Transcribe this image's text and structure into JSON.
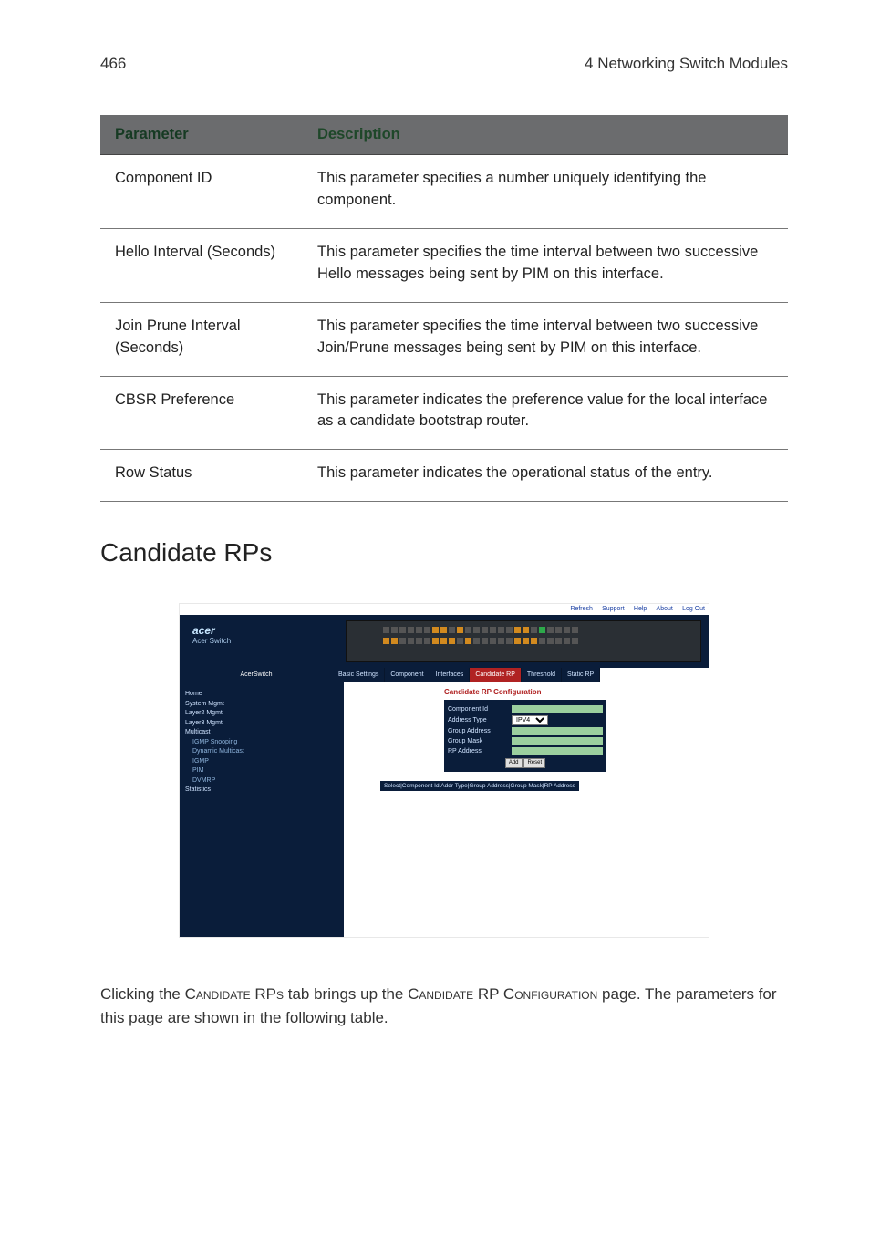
{
  "header": {
    "page_number": "466",
    "section": "4 Networking Switch Modules"
  },
  "table": {
    "col_param": "Parameter",
    "col_desc": "Description",
    "rows": [
      {
        "param": "Component ID",
        "desc": "This parameter specifies a number uniquely identifying the component."
      },
      {
        "param": "Hello Interval (Seconds)",
        "desc": "This parameter specifies the time interval between two successive Hello messages being sent by PIM on this interface."
      },
      {
        "param": "Join Prune Interval (Seconds)",
        "desc": "This parameter specifies the time interval between two successive Join/Prune messages being sent by PIM on this interface."
      },
      {
        "param": "CBSR Preference",
        "desc": "This parameter indicates the preference value for the local interface as a candidate bootstrap router."
      },
      {
        "param": "Row Status",
        "desc": "This parameter indicates the operational status of the entry."
      }
    ]
  },
  "heading": "Candidate RPs",
  "screenshot": {
    "top_links": [
      "Refresh",
      "Support",
      "Help",
      "About",
      "Log Out"
    ],
    "brand": "acer",
    "brand_sub": "Acer Switch",
    "side_title_tab": "AcerSwitch",
    "tabs": [
      "Basic Settings",
      "Component",
      "Interfaces",
      "Candidate RP",
      "Threshold",
      "Static RP"
    ],
    "active_tab_index": 3,
    "side_links": {
      "home": "Home",
      "items": [
        "System Mgmt",
        "Layer2 Mgmt",
        "Layer3 Mgmt",
        "Multicast"
      ],
      "subitems": [
        "IGMP Snooping",
        "Dynamic Multicast",
        "IGMP",
        "PIM",
        "DVMRP"
      ],
      "last": "Statistics"
    },
    "form_title": "Candidate RP Configuration",
    "form": {
      "component_id": "Component Id",
      "address_type": "Address Type",
      "address_type_value": "IPV4",
      "group_address": "Group Address",
      "group_mask": "Group Mask",
      "rp_address": "RP Address",
      "btn_add": "Add",
      "btn_reset": "Reset"
    },
    "select_bar": "Select|Component Id|Addr Type|Group Address|Group Mask|RP Address"
  },
  "body_text": {
    "part1": "Clicking the ",
    "sc1": "Candidate RPs",
    "part2": " tab brings up the ",
    "sc2": "Candidate RP Configuration",
    "part3": " page. The parameters for this page are shown in the following table."
  }
}
